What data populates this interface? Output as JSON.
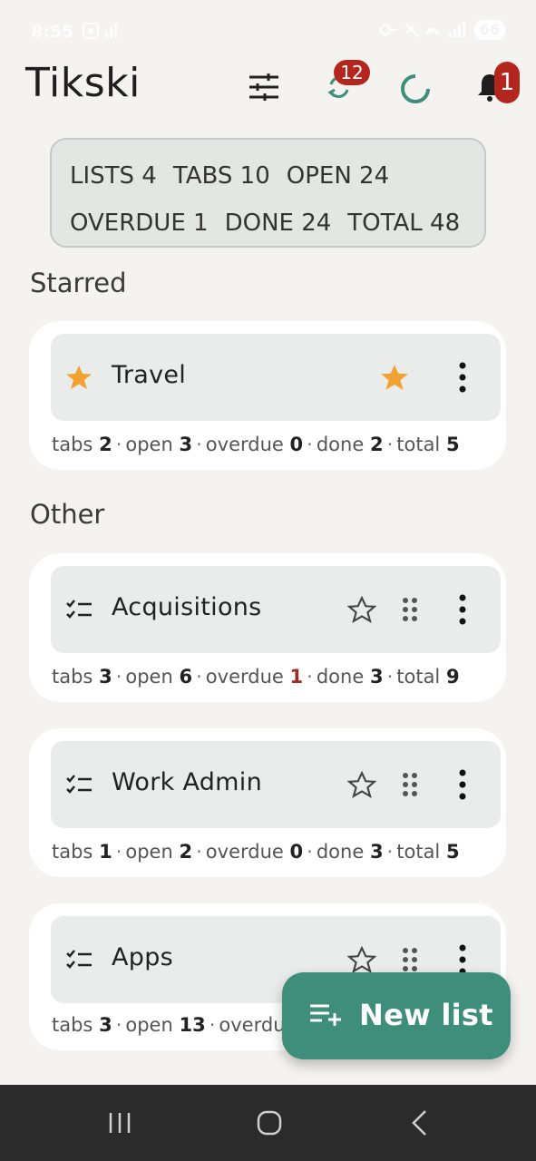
{
  "status": {
    "time": "8:55",
    "battery": "66"
  },
  "header": {
    "title": "Tikski",
    "sync_badge": "12",
    "notif_badge": "1",
    "icons": [
      "filter-icon",
      "sync-icon",
      "loading-spinner-icon",
      "bell-icon"
    ]
  },
  "stats": {
    "row1": [
      "LISTS 4",
      "TABS 10",
      "OPEN 24"
    ],
    "row2": [
      "OVERDUE 1",
      "DONE 24",
      "TOTAL 48"
    ]
  },
  "sections": {
    "starred": "Starred",
    "other": "Other"
  },
  "lists": [
    {
      "title": "Travel",
      "starred": true,
      "stats": {
        "tabs_label": "tabs",
        "tabs": "2",
        "open_label": "open",
        "open": "3",
        "overdue_label": "overdue",
        "overdue": "0",
        "done_label": "done",
        "done": "2",
        "total_label": "total",
        "total": "5"
      }
    },
    {
      "title": "Acquisitions",
      "starred": false,
      "stats": {
        "tabs_label": "tabs",
        "tabs": "3",
        "open_label": "open",
        "open": "6",
        "overdue_label": "overdue",
        "overdue": "1",
        "done_label": "done",
        "done": "3",
        "total_label": "total",
        "total": "9"
      }
    },
    {
      "title": "Work Admin",
      "starred": false,
      "stats": {
        "tabs_label": "tabs",
        "tabs": "1",
        "open_label": "open",
        "open": "2",
        "overdue_label": "overdue",
        "overdue": "0",
        "done_label": "done",
        "done": "3",
        "total_label": "total",
        "total": "5"
      }
    },
    {
      "title": "Apps",
      "starred": false,
      "stats": {
        "tabs_label": "tabs",
        "tabs": "3",
        "open_label": "open",
        "open": "13",
        "overdue_label": "overdu"
      }
    }
  ],
  "fab": {
    "label": "New list",
    "icon": "playlist-add-icon"
  },
  "colors": {
    "accent": "#3f8d7b",
    "star": "#f2a233",
    "badge": "#b3261e",
    "overdue": "#9b2a24"
  }
}
